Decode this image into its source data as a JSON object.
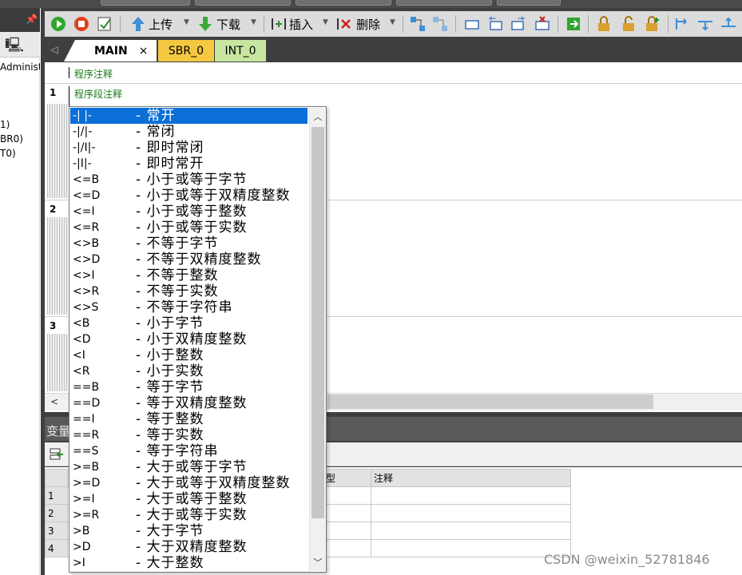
{
  "left_panel": {
    "tree_lines": [
      "Administr",
      "1)",
      "BR0)",
      "T0)"
    ]
  },
  "toolbar": {
    "upload_label": "上传",
    "download_label": "下载",
    "insert_label": "插入",
    "delete_label": "删除"
  },
  "tabs": [
    {
      "label": "MAIN",
      "close": "×"
    },
    {
      "label": "SBR_0"
    },
    {
      "label": "INT_0"
    }
  ],
  "editor": {
    "program_comment": "程序注释",
    "segment_comment": "程序段注释",
    "network_numbers": [
      "1",
      "2",
      "3"
    ]
  },
  "dropdown": {
    "items": [
      {
        "code": "-| |-",
        "desc": "- 常开"
      },
      {
        "code": "-|/|-",
        "desc": "- 常闭"
      },
      {
        "code": "-|/I|-",
        "desc": "- 即时常闭"
      },
      {
        "code": "-|I|-",
        "desc": "- 即时常开"
      },
      {
        "code": "<=B",
        "desc": "- 小于或等于字节"
      },
      {
        "code": "<=D",
        "desc": "- 小于或等于双精度整数"
      },
      {
        "code": "<=I",
        "desc": "- 小于或等于整数"
      },
      {
        "code": "<=R",
        "desc": "- 小于或等于实数"
      },
      {
        "code": "<>B",
        "desc": "- 不等于字节"
      },
      {
        "code": "<>D",
        "desc": "- 不等于双精度整数"
      },
      {
        "code": "<>I",
        "desc": "- 不等于整数"
      },
      {
        "code": "<>R",
        "desc": "- 不等于实数"
      },
      {
        "code": "<>S",
        "desc": "- 不等于字符串"
      },
      {
        "code": "<B",
        "desc": "- 小于字节"
      },
      {
        "code": "<D",
        "desc": "- 小于双精度整数"
      },
      {
        "code": "<I",
        "desc": "- 小于整数"
      },
      {
        "code": "<R",
        "desc": "- 小于实数"
      },
      {
        "code": "==B",
        "desc": "- 等于字节"
      },
      {
        "code": "==D",
        "desc": "- 等于双精度整数"
      },
      {
        "code": "==I",
        "desc": "- 等于整数"
      },
      {
        "code": "==R",
        "desc": "- 等于实数"
      },
      {
        "code": "==S",
        "desc": "- 等于字符串"
      },
      {
        "code": ">=B",
        "desc": "- 大于或等于字节"
      },
      {
        "code": ">=D",
        "desc": "- 大于或等于双精度整数"
      },
      {
        "code": ">=I",
        "desc": "- 大于或等于整数"
      },
      {
        "code": ">=R",
        "desc": "- 大于或等于实数"
      },
      {
        "code": ">B",
        "desc": "- 大于字节"
      },
      {
        "code": ">D",
        "desc": "- 大于双精度整数"
      },
      {
        "code": ">I",
        "desc": "- 大于整数"
      }
    ]
  },
  "var_panel": {
    "title": "变量",
    "col_type": "型",
    "col_comment": "注释",
    "rows": [
      "1",
      "2",
      "3",
      "4"
    ]
  },
  "watermark": "CSDN @weixin_52781846",
  "colors": {
    "selection": "#0a6fd6",
    "sbr_tab": "#f5c842",
    "int_tab": "#c8e6a0",
    "comment_green": "#1a7a1a"
  }
}
